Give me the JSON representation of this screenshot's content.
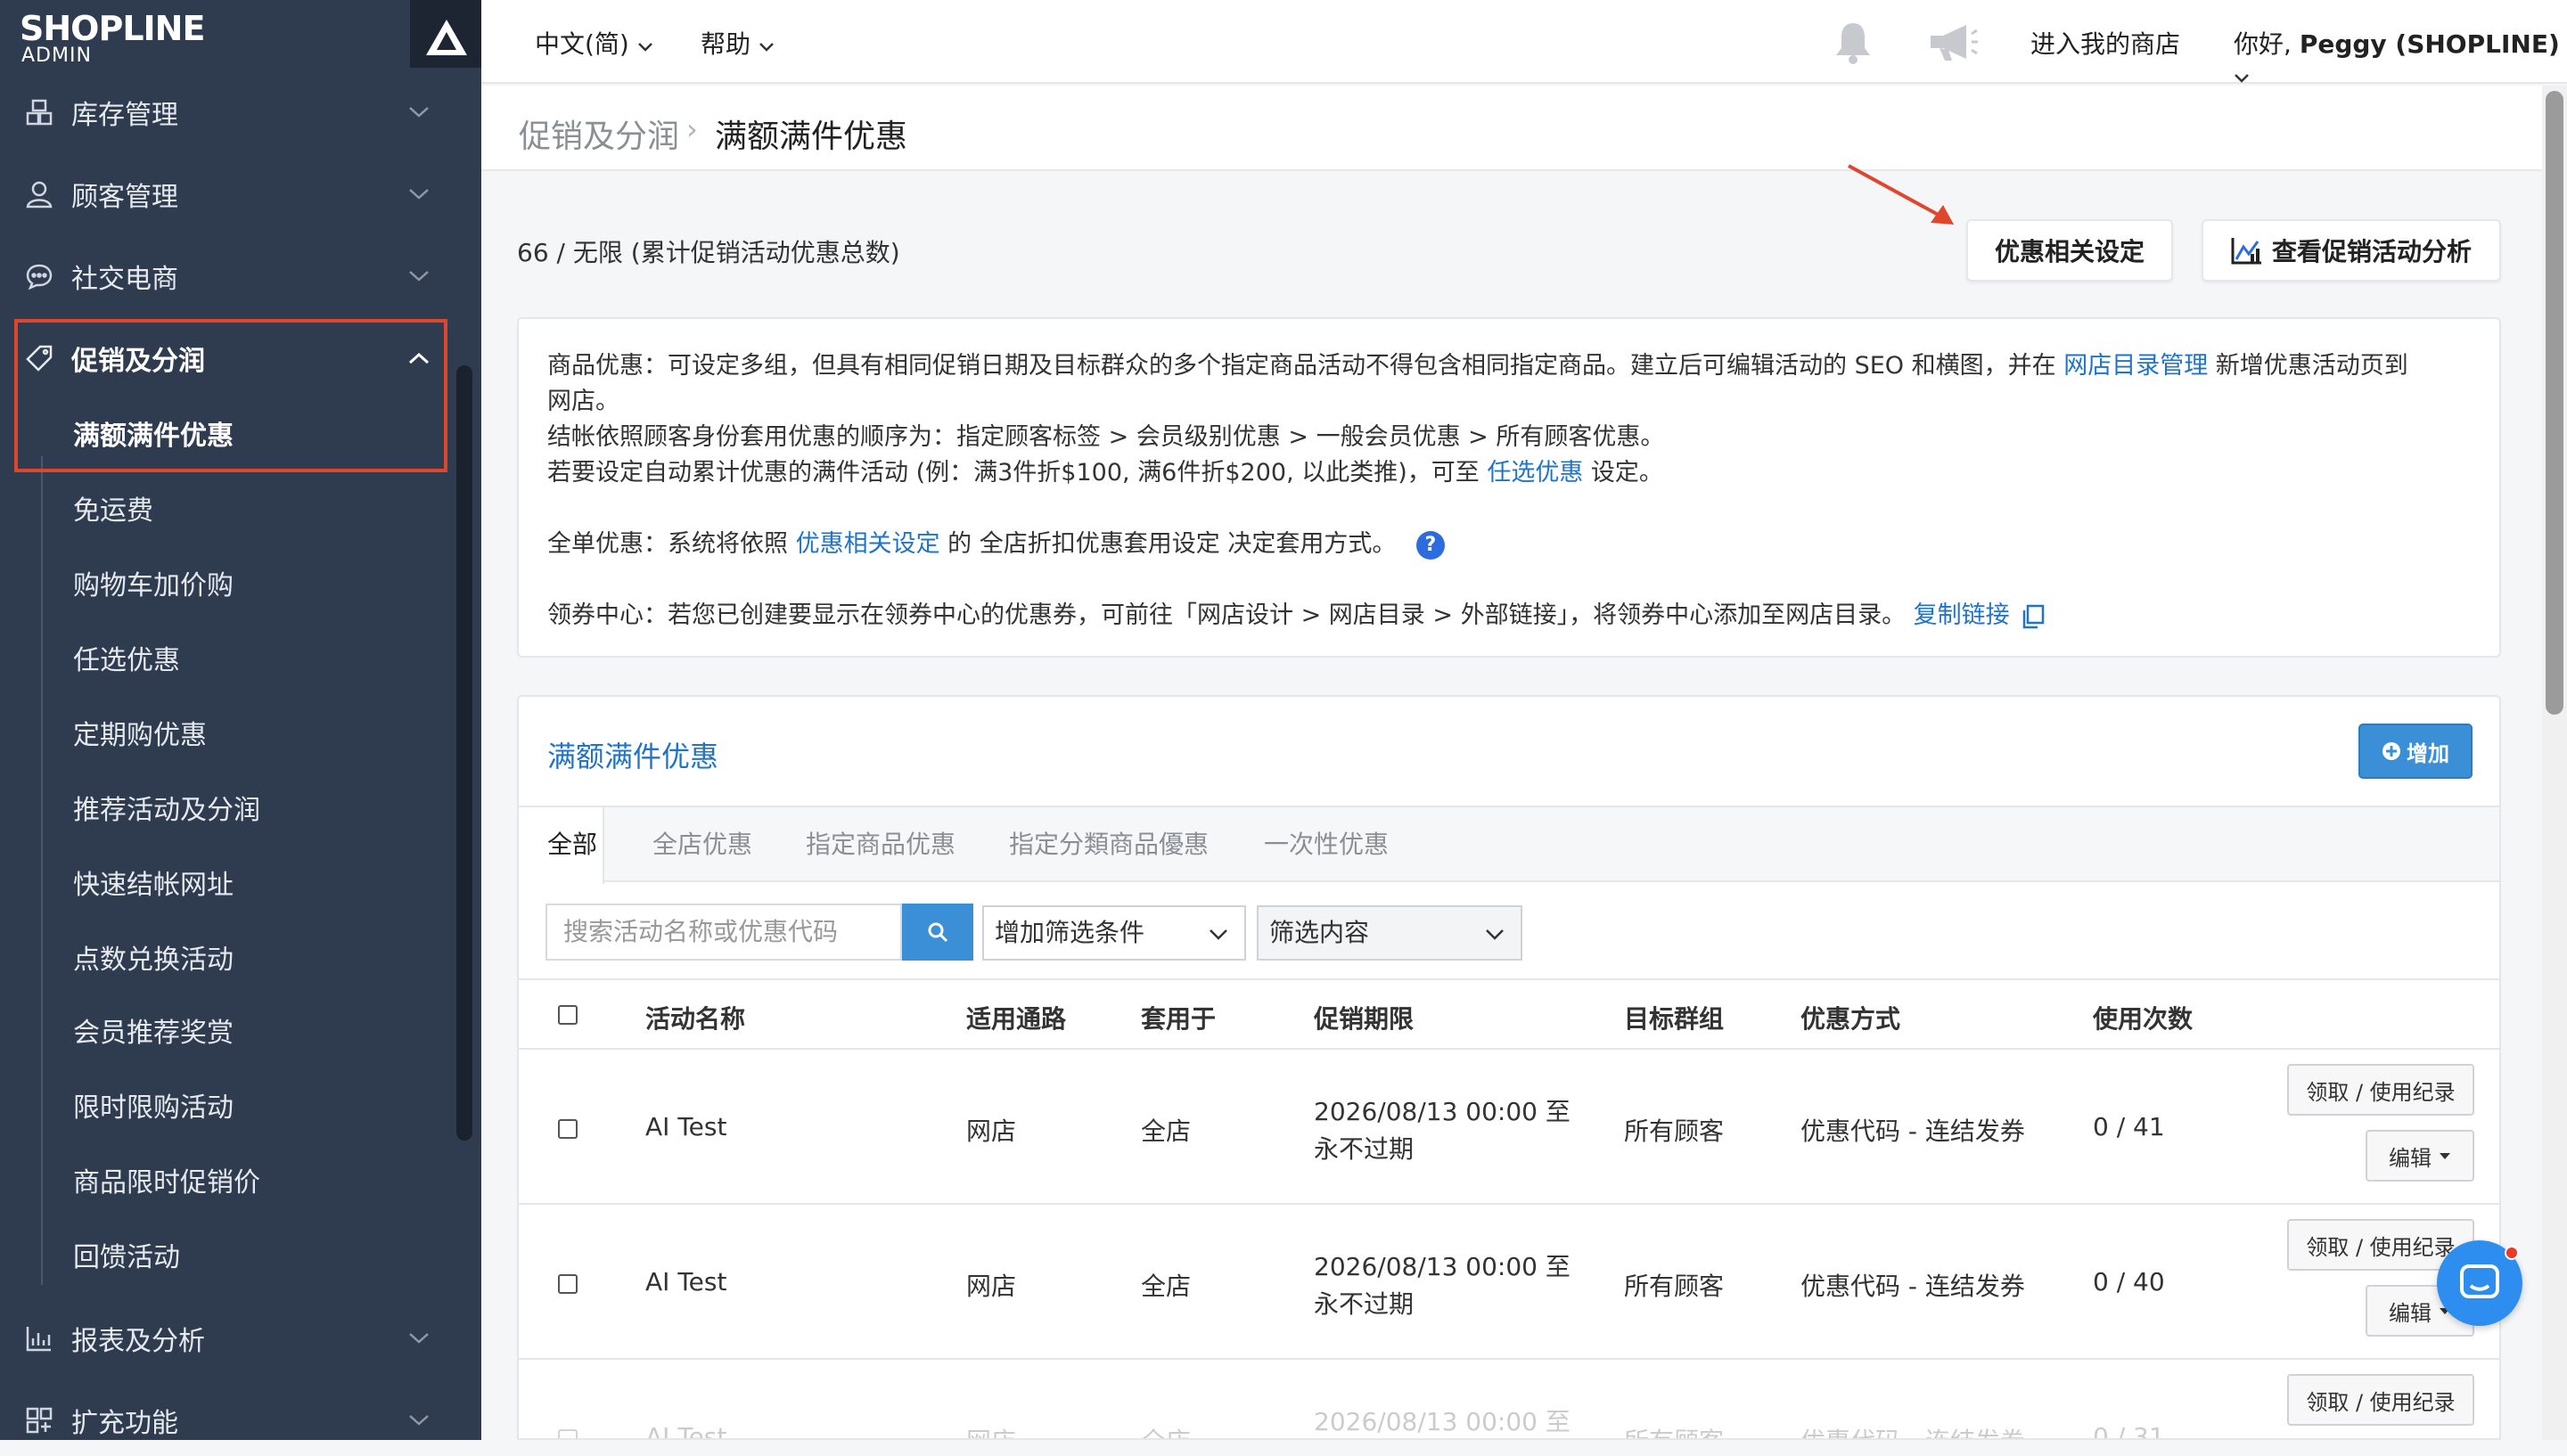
{
  "sidebar": {
    "brand": "SHOPLINE",
    "brand_sub": "ADMIN",
    "items": [
      {
        "label": "库存管理",
        "icon": "inventory-icon"
      },
      {
        "label": "顾客管理",
        "icon": "customer-icon"
      },
      {
        "label": "社交电商",
        "icon": "chat-bubble-icon"
      },
      {
        "label": "促销及分润",
        "icon": "tag-icon"
      },
      {
        "label": "报表及分析",
        "icon": "chart-icon"
      },
      {
        "label": "扩充功能",
        "icon": "apps-icon"
      }
    ],
    "sub_items": [
      "满额满件优惠",
      "免运费",
      "购物车加价购",
      "任选优惠",
      "定期购优惠",
      "推荐活动及分润",
      "快速结帐网址",
      "点数兑换活动",
      "会员推荐奖赏",
      "限时限购活动",
      "商品限时促销价",
      "回馈活动"
    ]
  },
  "topbar": {
    "language": "中文(简)",
    "help": "帮助",
    "enter_store": "进入我的商店",
    "greeting_prefix": "你好, ",
    "user": "Peggy (SHOPLINE)"
  },
  "breadcrumb": {
    "parent": "促销及分润",
    "separator": "›",
    "current": "满额满件优惠"
  },
  "summary": {
    "count_text": "66 / 无限 (累计促销活动优惠总数)",
    "settings_button": "优惠相关设定",
    "analytics_button": "查看促销活动分析"
  },
  "info": {
    "line1_a": "商品优惠：可设定多组，但具有相同促销日期及目标群众的多个指定商品活动不得包含相同指定商品。建立后可编辑活动的 SEO 和横图，并在 ",
    "line1_link": "网店目录管理",
    "line1_b": " 新增优惠活动页到",
    "line2": "网店。",
    "line3": "结帐依照顾客身份套用优惠的顺序为：指定顾客标签 > 会员级别优惠 > 一般会员优惠 > 所有顾客优惠。",
    "line4_a": "若要设定自动累计优惠的满件活动 (例：满3件折$100, 满6件折$200, 以此类推)，可至 ",
    "line4_link": "任选优惠",
    "line4_b": " 设定。",
    "line5_a": "全单优惠：系统将依照 ",
    "line5_link": "优惠相关设定",
    "line5_b": " 的 全店折扣优惠套用设定 决定套用方式。",
    "line6_a": "领券中心：若您已创建要显示在领券中心的优惠券，可前往「网店设计 > 网店目录 > 外部链接」，将领券中心添加至网店目录。 ",
    "line6_link": "复制链接"
  },
  "panel": {
    "title": "满额满件优惠",
    "add_button": "增加",
    "tabs": [
      "全部",
      "全店优惠",
      "指定商品优惠",
      "指定分類商品優惠",
      "一次性优惠"
    ],
    "search_placeholder": "搜索活动名称或优惠代码",
    "filter_add": "增加筛选条件",
    "filter_content": "筛选内容",
    "columns": [
      "活动名称",
      "适用通路",
      "套用于",
      "促销期限",
      "目标群组",
      "优惠方式",
      "使用次数"
    ],
    "rows": [
      {
        "name": "AI Test",
        "channel": "网店",
        "apply": "全店",
        "period_a": "2026/08/13 00:00 至",
        "period_b": "永不过期",
        "group": "所有顾客",
        "method": "优惠代码 - 连结发券",
        "usage": "0 / 41"
      },
      {
        "name": "AI Test",
        "channel": "网店",
        "apply": "全店",
        "period_a": "2026/08/13 00:00 至",
        "period_b": "永不过期",
        "group": "所有顾客",
        "method": "优惠代码 - 连结发券",
        "usage": "0 / 40"
      },
      {
        "name": "AI Test",
        "channel": "网店",
        "apply": "全店",
        "period_a": "2026/08/13 00:00 至",
        "period_b": "",
        "group": "所有顾客",
        "method": "优惠代码 - 连结发券",
        "usage": "0 / 31"
      }
    ],
    "row_btn_records": "领取 / 使用纪录",
    "row_btn_edit": "编辑"
  },
  "colors": {
    "sidebar": "#2f3c50",
    "accent": "#3a8fd6",
    "highlight": "#e0462d",
    "link": "#1f74c9"
  }
}
